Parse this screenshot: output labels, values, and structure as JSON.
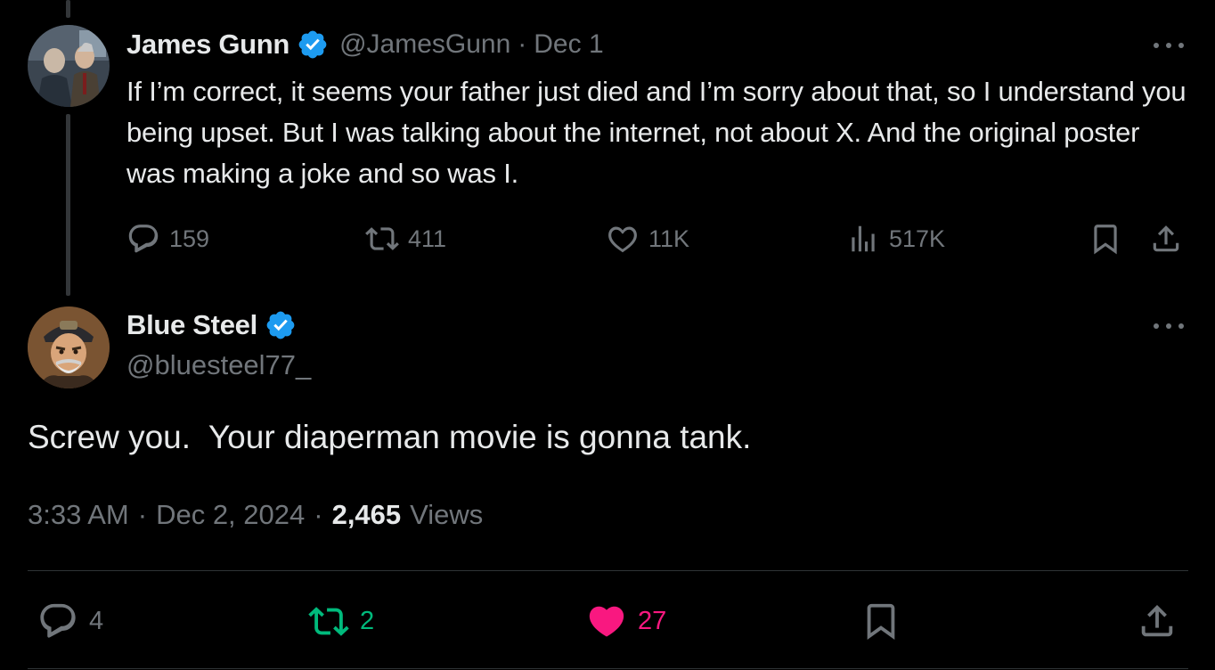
{
  "reply_tweet": {
    "author_name": "James Gunn",
    "handle": "@JamesGunn",
    "separator": "·",
    "date": "Dec 1",
    "text": "If I’m correct, it seems your father just died and I’m sorry about that, so I understand you being upset. But I was talking about the internet, not about X. And the original poster was making a joke and so was I.",
    "stats": {
      "replies": "159",
      "retweets": "411",
      "likes": "11K",
      "views": "517K"
    },
    "icons": [
      "reply-icon",
      "retweet-icon",
      "like-icon",
      "views-icon",
      "bookmark-icon",
      "share-icon",
      "more-icon",
      "verified-icon"
    ]
  },
  "main_tweet": {
    "author_name": "Blue Steel",
    "handle": "@bluesteel77_",
    "text": "Screw you.  Your diaperman movie is gonna tank.",
    "time": "3:33 AM",
    "separator": "·",
    "date": "Dec 2, 2024",
    "views_count": "2,465",
    "views_label": "Views",
    "stats": {
      "replies": "4",
      "retweets": "2",
      "likes": "27"
    },
    "retweeted": true,
    "liked": true
  },
  "colors": {
    "background": "#000000",
    "text_primary": "#e7e9ea",
    "text_secondary": "#71767b",
    "verified_blue": "#1d9bf0",
    "retweet_green": "#00ba7c",
    "like_pink": "#f91880",
    "divider": "#2f3336"
  }
}
